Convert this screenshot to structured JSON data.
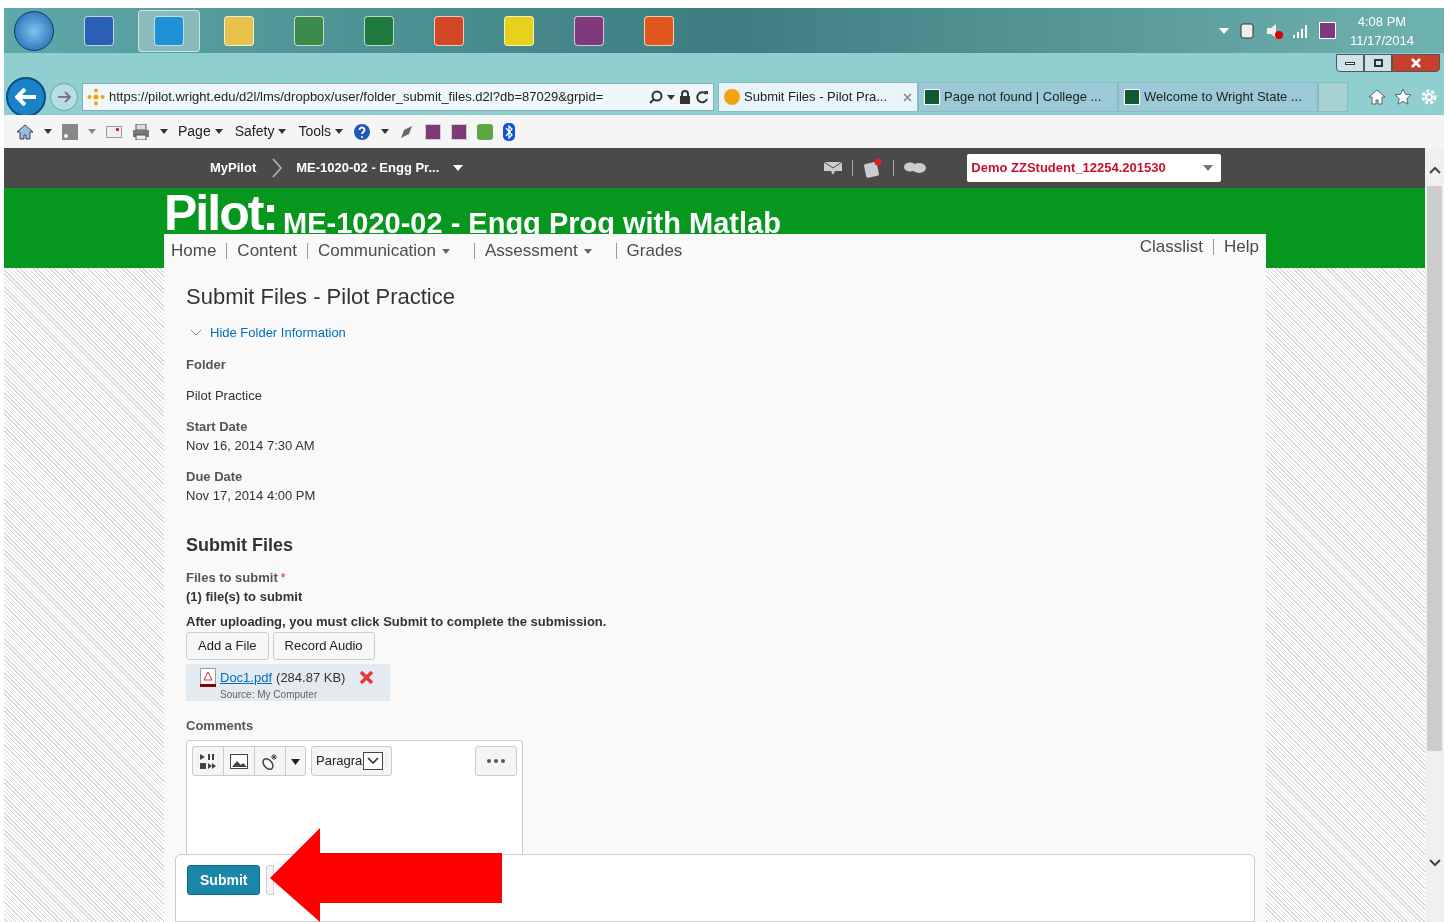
{
  "taskbar": {
    "apps": [
      {
        "color": "#2b5fb4",
        "selected": false
      },
      {
        "color": "#1f8fd6",
        "selected": true
      },
      {
        "color": "#e8c24a",
        "selected": false
      },
      {
        "color": "#3a8a4a",
        "selected": false
      },
      {
        "color": "#1e7a3c",
        "selected": false
      },
      {
        "color": "#d24726",
        "selected": false
      },
      {
        "color": "#e6d21a",
        "selected": false
      },
      {
        "color": "#80397b",
        "selected": false
      },
      {
        "color": "#e0561c",
        "selected": false
      }
    ],
    "time": "4:08 PM",
    "date": "11/17/2014"
  },
  "browser": {
    "url": "https://pilot.wright.edu/d2l/lms/dropbox/user/folder_submit_files.d2l?db=87029&grpid=",
    "tabs": [
      {
        "title": "Submit Files - Pilot Pra...",
        "selected": true,
        "closable": true
      },
      {
        "title": "Page not found | College ...",
        "selected": false,
        "closable": false
      },
      {
        "title": "Welcome to Wright State ...",
        "selected": false,
        "closable": false
      }
    ],
    "commands": [
      "Page",
      "Safety",
      "Tools"
    ]
  },
  "minibar": {
    "home": "MyPilot",
    "course": "ME-1020-02 - Engg Pr...",
    "user": "Demo ZZStudent_12254.201530"
  },
  "header": {
    "logo": "Pilot:",
    "course_title": "ME-1020-02 - Engg Prog with Matlab"
  },
  "nav": {
    "left": [
      {
        "label": "Home",
        "menu": false
      },
      {
        "label": "Content",
        "menu": false
      },
      {
        "label": "Communication",
        "menu": true
      },
      {
        "label": "Assessment",
        "menu": true
      },
      {
        "label": "Grades",
        "menu": false
      }
    ],
    "right": [
      "Classlist",
      "Help"
    ]
  },
  "content": {
    "title": "Submit Files - Pilot Practice",
    "toggle": "Hide Folder Information",
    "fields": [
      {
        "label": "Folder",
        "value": "Pilot Practice"
      },
      {
        "label": "Start Date",
        "value": "Nov 16, 2014 7:30 AM"
      },
      {
        "label": "Due Date",
        "value": "Nov 17, 2014 4:00 PM"
      }
    ],
    "section": "Submit Files",
    "files_label": "Files to submit",
    "required": "*",
    "file_count": "(1) file(s) to submit",
    "instruction": "After uploading, you must click Submit to complete the submission.",
    "buttons": [
      "Add a File",
      "Record Audio"
    ],
    "file": {
      "name": "Doc1.pdf",
      "size": "(284.87 KB)",
      "source": "Source: My Computer"
    },
    "comments_label": "Comments",
    "format": "Paragra",
    "submit": "Submit"
  }
}
